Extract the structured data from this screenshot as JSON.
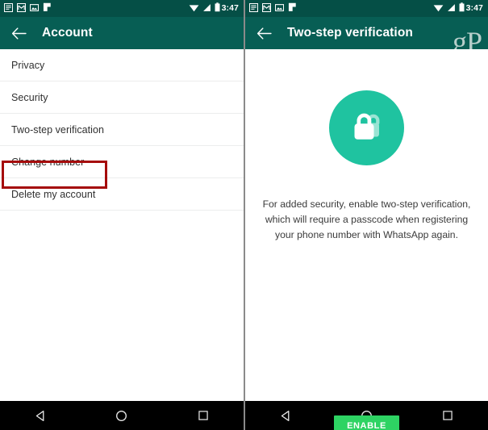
{
  "colors": {
    "status_bar": "#054F46",
    "app_bar": "#075E54",
    "lock_circle": "#1FC3A0",
    "enable_button": "#2ED363",
    "highlight_box": "#A50B0B",
    "nav_bar": "#000000",
    "watermark": "#CFDEDB"
  },
  "status_bar": {
    "clock": "3:47",
    "notification_icons": [
      "news-article-icon",
      "gmail-envelope-icon",
      "photo-image-icon",
      "flag-icon"
    ],
    "system_icons": [
      "wifi-icon",
      "cellular-signal-icon",
      "battery-icon"
    ]
  },
  "left_screen": {
    "app_bar": {
      "back_icon": "back-arrow-icon",
      "title": "Account"
    },
    "list": {
      "items": [
        {
          "label": "Privacy",
          "highlighted": false
        },
        {
          "label": "Security",
          "highlighted": false
        },
        {
          "label": "Two-step verification",
          "highlighted": true
        },
        {
          "label": "Change number",
          "highlighted": false
        },
        {
          "label": "Delete my account",
          "highlighted": false
        }
      ]
    }
  },
  "right_screen": {
    "app_bar": {
      "back_icon": "back-arrow-icon",
      "title": "Two-step verification",
      "watermark": "gP"
    },
    "hero": {
      "icon": "double-padlock-icon"
    },
    "description": "For added security, enable two-step verification, which will require a passcode when registering your phone number with WhatsApp again.",
    "enable_label": "ENABLE"
  },
  "nav_bar": {
    "back_label": "back-triangle-icon",
    "home_label": "home-circle-icon",
    "recents_label": "recents-square-icon"
  }
}
